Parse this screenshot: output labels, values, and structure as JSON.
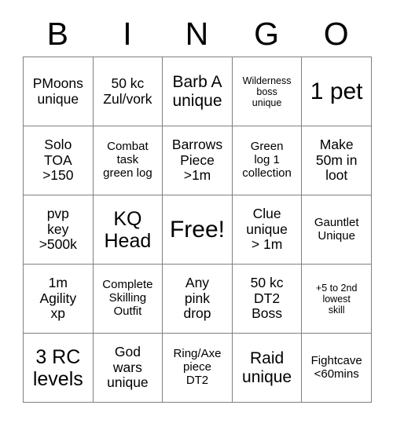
{
  "header": {
    "letters": [
      "B",
      "I",
      "N",
      "G",
      "O"
    ]
  },
  "grid": {
    "rows": [
      [
        {
          "text": "PMoons\nunique",
          "size": "fs-m"
        },
        {
          "text": "50 kc\nZul/vork",
          "size": "fs-m"
        },
        {
          "text": "Barb A\nunique",
          "size": "fs-l"
        },
        {
          "text": "Wilderness\nboss\nunique",
          "size": "fs-xs"
        },
        {
          "text": "1 pet",
          "size": "fs-xxl"
        }
      ],
      [
        {
          "text": "Solo\nTOA\n>150",
          "size": "fs-m"
        },
        {
          "text": "Combat\ntask\ngreen log",
          "size": "fs-s"
        },
        {
          "text": "Barrows\nPiece\n>1m",
          "size": "fs-m"
        },
        {
          "text": "Green\nlog 1\ncollection",
          "size": "fs-s"
        },
        {
          "text": "Make\n50m in\nloot",
          "size": "fs-m"
        }
      ],
      [
        {
          "text": "pvp\nkey\n>500k",
          "size": "fs-m"
        },
        {
          "text": "KQ\nHead",
          "size": "fs-xl"
        },
        {
          "text": "Free!",
          "size": "fs-xxl"
        },
        {
          "text": "Clue\nunique\n> 1m",
          "size": "fs-m"
        },
        {
          "text": "Gauntlet\nUnique",
          "size": "fs-s"
        }
      ],
      [
        {
          "text": "1m\nAgility\nxp",
          "size": "fs-m"
        },
        {
          "text": "Complete\nSkilling\nOutfit",
          "size": "fs-s"
        },
        {
          "text": "Any\npink\ndrop",
          "size": "fs-m"
        },
        {
          "text": "50 kc\nDT2\nBoss",
          "size": "fs-m"
        },
        {
          "text": "+5 to 2nd\nlowest\nskill",
          "size": "fs-xs"
        }
      ],
      [
        {
          "text": "3 RC\nlevels",
          "size": "fs-xl"
        },
        {
          "text": "God\nwars\nunique",
          "size": "fs-m"
        },
        {
          "text": "Ring/Axe\npiece\nDT2",
          "size": "fs-s"
        },
        {
          "text": "Raid\nunique",
          "size": "fs-l"
        },
        {
          "text": "Fightcave\n<60mins",
          "size": "fs-s"
        }
      ]
    ]
  }
}
